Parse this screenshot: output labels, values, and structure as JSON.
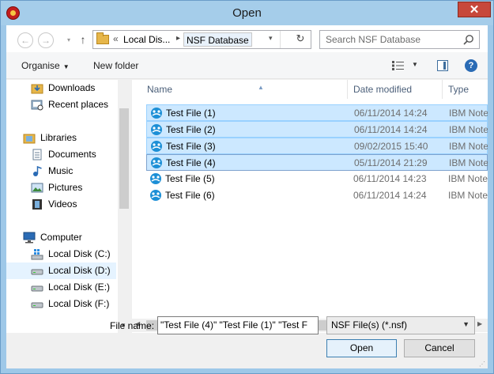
{
  "window": {
    "title": "Open",
    "close_glyph": "✕"
  },
  "nav": {
    "back_glyph": "←",
    "forward_glyph": "→",
    "recent_glyph": "▾",
    "up_glyph": "↑",
    "address": {
      "chevron": "«",
      "segment1": "Local Dis...",
      "separator": "▸",
      "segment2": "NSF Database",
      "dropdown_glyph": "▾",
      "refresh_glyph": "↻"
    },
    "search_placeholder": "Search NSF Database"
  },
  "toolbar": {
    "organise": "Organise",
    "organise_caret": "▼",
    "new_folder": "New folder",
    "view_caret": "▼",
    "help_glyph": "?"
  },
  "sidebar": {
    "items": [
      {
        "label": "Downloads",
        "icon": "downloads-folder-icon"
      },
      {
        "label": "Recent places",
        "icon": "recent-places-icon"
      },
      {
        "label": "Libraries",
        "icon": "libraries-icon"
      },
      {
        "label": "Documents",
        "icon": "documents-icon"
      },
      {
        "label": "Music",
        "icon": "music-icon"
      },
      {
        "label": "Pictures",
        "icon": "pictures-icon"
      },
      {
        "label": "Videos",
        "icon": "videos-icon"
      },
      {
        "label": "Computer",
        "icon": "computer-icon"
      },
      {
        "label": "Local Disk (C:)",
        "icon": "windows-disk-icon"
      },
      {
        "label": "Local Disk (D:)",
        "icon": "disk-icon",
        "selected": true
      },
      {
        "label": "Local Disk (E:)",
        "icon": "disk-icon"
      },
      {
        "label": "Local Disk (F:)",
        "icon": "disk-icon"
      }
    ]
  },
  "files": {
    "columns": {
      "name": "Name",
      "date": "Date modified",
      "type": "Type"
    },
    "rows": [
      {
        "name": "Test File (1)",
        "date": "06/11/2014 14:24",
        "type": "IBM Notes",
        "selected": true
      },
      {
        "name": "Test File (2)",
        "date": "06/11/2014 14:24",
        "type": "IBM Notes",
        "selected": true
      },
      {
        "name": "Test File (3)",
        "date": "09/02/2015 15:40",
        "type": "IBM Notes",
        "selected": true
      },
      {
        "name": "Test File (4)",
        "date": "05/11/2014 21:29",
        "type": "IBM Notes",
        "selected": true
      },
      {
        "name": "Test File (5)",
        "date": "06/11/2014 14:23",
        "type": "IBM Notes",
        "selected": false
      },
      {
        "name": "Test File (6)",
        "date": "06/11/2014 14:24",
        "type": "IBM Notes",
        "selected": false
      }
    ]
  },
  "footer": {
    "filename_label": "File name:",
    "filename_value": "\"Test File (4)\" \"Test File (1)\" \"Test F",
    "filetype_value": "NSF File(s) (*.nsf)",
    "filetype_caret": "▼",
    "open_label": "Open",
    "cancel_label": "Cancel"
  },
  "colors": {
    "accent": "#3c7fb1",
    "selection": "#cce8ff",
    "titlebar": "#a5cdea",
    "close": "#c7483b"
  }
}
